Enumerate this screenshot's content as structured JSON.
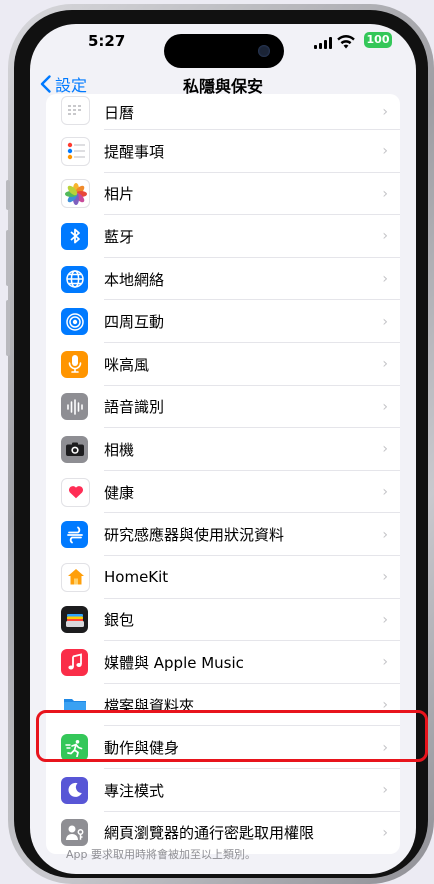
{
  "status_bar": {
    "time": "5:27",
    "battery": "100"
  },
  "nav": {
    "back_label": "設定",
    "title": "私隱與保安"
  },
  "rows": [
    {
      "label": "日曆",
      "icon": "calendar-icon"
    },
    {
      "label": "提醒事項",
      "icon": "reminders-icon"
    },
    {
      "label": "相片",
      "icon": "photos-icon"
    },
    {
      "label": "藍牙",
      "icon": "bluetooth-icon"
    },
    {
      "label": "本地網絡",
      "icon": "local-network-icon"
    },
    {
      "label": "四周互動",
      "icon": "nearby-interactions-icon"
    },
    {
      "label": "咪高風",
      "icon": "microphone-icon"
    },
    {
      "label": "語音識別",
      "icon": "speech-recognition-icon"
    },
    {
      "label": "相機",
      "icon": "camera-icon"
    },
    {
      "label": "健康",
      "icon": "health-icon"
    },
    {
      "label": "研究感應器與使用狀況資料",
      "icon": "research-sensor-icon"
    },
    {
      "label": "HomeKit",
      "icon": "homekit-icon"
    },
    {
      "label": "銀包",
      "icon": "wallet-icon"
    },
    {
      "label": "媒體與 Apple Music",
      "icon": "apple-music-icon"
    },
    {
      "label": "檔案與資料夾",
      "icon": "files-icon"
    },
    {
      "label": "動作與健身",
      "icon": "motion-fitness-icon"
    },
    {
      "label": "專注模式",
      "icon": "focus-icon"
    },
    {
      "label": "網頁瀏覽器的通行密匙取用權限",
      "icon": "passkeys-icon"
    }
  ],
  "footer_note": "App 要求取用時將會被加至以上類別。",
  "colors": {
    "accent": "#007aff",
    "highlight": "#e8141c",
    "background": "#f2f2f7"
  }
}
